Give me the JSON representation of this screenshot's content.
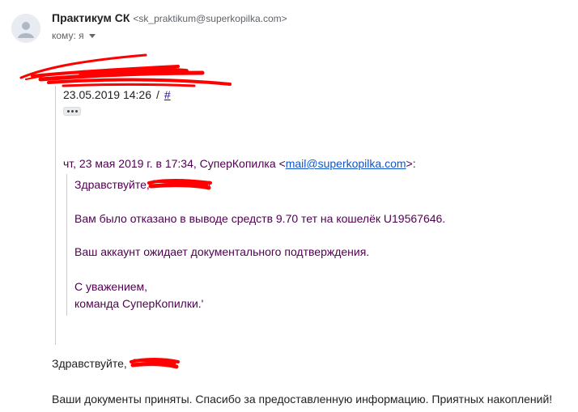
{
  "header": {
    "sender_name": "Практикум СК",
    "sender_email": "<sk_praktikum@superkopilka.com>",
    "to_label": "кому: я"
  },
  "quote": {
    "date": "23.05.2019 14:26",
    "separator": "/",
    "link": "#"
  },
  "attribution": {
    "prefix": "чт, 23 мая 2019 г. в 17:34, СуперКопилка <",
    "email": "mail@superkopilka.com",
    "suffix": ">:"
  },
  "quoted_body": {
    "greeting_start": "Здравствуйте,",
    "greeting_end": "!",
    "line1": "Вам было отказано в выводе средств 9.70 тет на кошелёк U19567646.",
    "line2": "Ваш аккаунт ожидает документального подтверждения.",
    "line3": "С уважением,",
    "line4": "команда СуперКопилки.'"
  },
  "reply_body": {
    "greeting": "Здравствуйте,",
    "line1": "Ваши документы приняты. Спасибо за предоставленную информацию. Приятных накоплений!"
  },
  "colors": {
    "redaction": "#ff0000",
    "quoted_text": "#500050",
    "link": "#1155cc"
  },
  "icons": {
    "avatar": "default-avatar-icon",
    "to_dropdown": "caret-down-icon",
    "trimmed_content": "ellipsis-icon"
  }
}
